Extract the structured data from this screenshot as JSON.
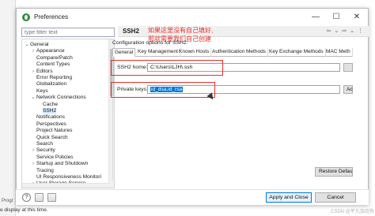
{
  "window": {
    "title": "Preferences"
  },
  "filter": {
    "placeholder": "type filter text"
  },
  "tree": [
    {
      "label": "General",
      "twisty": "⌄",
      "indent": 0
    },
    {
      "label": "Appearance",
      "twisty": "›",
      "indent": 1
    },
    {
      "label": "Compare/Patch",
      "twisty": "",
      "indent": 1
    },
    {
      "label": "Content Types",
      "twisty": "",
      "indent": 1
    },
    {
      "label": "Editors",
      "twisty": "›",
      "indent": 1
    },
    {
      "label": "Error Reporting",
      "twisty": "",
      "indent": 1
    },
    {
      "label": "Globalization",
      "twisty": "",
      "indent": 1
    },
    {
      "label": "Keys",
      "twisty": "",
      "indent": 1
    },
    {
      "label": "Network Connections",
      "twisty": "⌄",
      "indent": 1
    },
    {
      "label": "Cache",
      "twisty": "",
      "indent": 2
    },
    {
      "label": "SSH2",
      "twisty": "",
      "indent": 2,
      "selected": true
    },
    {
      "label": "Notifications",
      "twisty": "",
      "indent": 1
    },
    {
      "label": "Perspectives",
      "twisty": "",
      "indent": 1
    },
    {
      "label": "Project Natures",
      "twisty": "",
      "indent": 1
    },
    {
      "label": "Quick Search",
      "twisty": "",
      "indent": 1
    },
    {
      "label": "Search",
      "twisty": "",
      "indent": 1
    },
    {
      "label": "Security",
      "twisty": "›",
      "indent": 1
    },
    {
      "label": "Service Policies",
      "twisty": "",
      "indent": 1
    },
    {
      "label": "Startup and Shutdown",
      "twisty": "›",
      "indent": 1
    },
    {
      "label": "Tracing",
      "twisty": "",
      "indent": 1
    },
    {
      "label": "UI Responsiveness Monitori",
      "twisty": "",
      "indent": 1
    },
    {
      "label": "User Storage Service",
      "twisty": "›",
      "indent": 1
    }
  ],
  "panel": {
    "title": "SSH2",
    "config_label": "Configuration options for SSH2:",
    "tabs": [
      "General",
      "Key Management",
      "Known Hosts",
      "Authentication Methods",
      "Key Exchange Methods",
      "MAC Meth"
    ],
    "ssh2_home_label": "SSH2 home:",
    "ssh2_home_value": "C:\\Users\\LJH\\.ssh",
    "private_keys_label": "Private keys:",
    "private_keys_value": "id_dsa,id_rsa",
    "add_label": "Ac",
    "restore_label": "Restore Defau"
  },
  "annotation": {
    "line1": "如果这里没有自己填好,",
    "line2": "那就需要我们自己创建"
  },
  "footer": {
    "apply_close_label": "Apply and Close",
    "cancel_label": "Cancel"
  },
  "background": {
    "status_text": "e display at this time.",
    "side_label": "Progr",
    "watermark": "CSDN @平凡加班狗"
  },
  "colors": {
    "annotation_red": "#e8302a",
    "selection_blue": "#0078d7",
    "tree_selected": "#cde8ff"
  }
}
